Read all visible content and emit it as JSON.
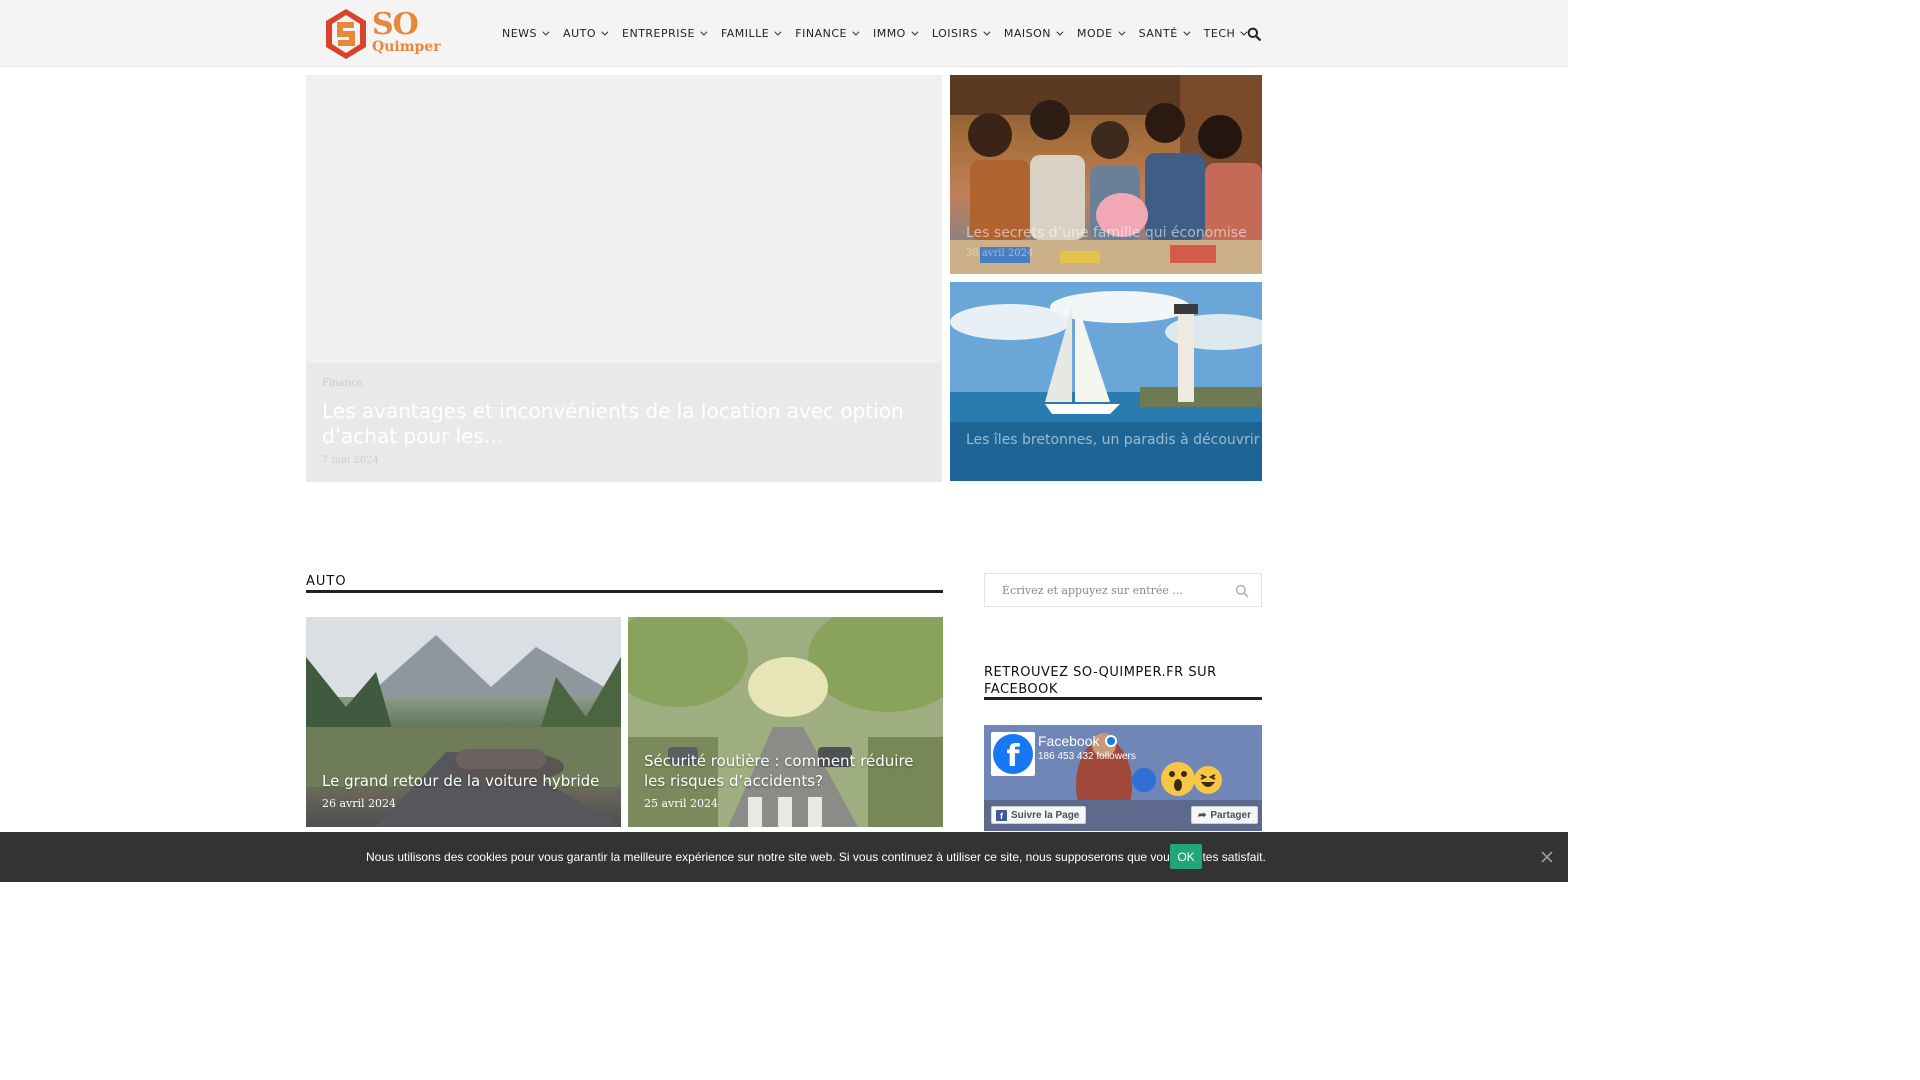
{
  "header": {
    "logo_so": "SO",
    "logo_city": "Quimper",
    "nav": [
      "NEWS",
      "AUTO",
      "ENTREPRISE",
      "FAMILLE",
      "FINANCE",
      "IMMO",
      "LOISIRS",
      "MAISON",
      "MODE",
      "SANTÉ",
      "TECH"
    ],
    "search_icon": "search-icon"
  },
  "hero": {
    "main": {
      "category": "Finance",
      "title": "Les avantages et inconvénients de la location avec option d’achat pour les…",
      "date": "7 mai 2024"
    },
    "side": [
      {
        "title": "Les secrets d’une famille qui économise",
        "date": "30 avril 2024"
      },
      {
        "title": "Les îles bretonnes, un paradis à découvrir"
      }
    ]
  },
  "auto_section": {
    "title": "AUTO",
    "cards": [
      {
        "title": "Le grand retour de la voiture hybride",
        "date": "26 avril 2024"
      },
      {
        "title": "Sécurité routière : comment réduire les risques d’accidents?",
        "date": "25 avril 2024"
      }
    ]
  },
  "sidebar": {
    "search_placeholder": "Écrivez et appuyez sur entrée ...",
    "fb_heading": "RETROUVEZ SO-QUIMPER.FR SUR FACEBOOK",
    "fb_page_name": "Facebook",
    "fb_followers": "186 453 432 followers",
    "fb_follow_label": "Suivre la Page",
    "fb_share_label": "Partager"
  },
  "cookie": {
    "text": "Nous utilisons des cookies pour vous garantir la meilleure expérience sur notre site web. Si vous continuez à utiliser ce site, nous supposerons que vous en êtes satisfait.",
    "ok_label": "OK"
  },
  "colors": {
    "accent_orange": "#e8873a",
    "logo_red": "#d9432c",
    "cookie_bg": "#333333",
    "ok_green": "#21a67a",
    "facebook_blue": "#1877f2"
  }
}
